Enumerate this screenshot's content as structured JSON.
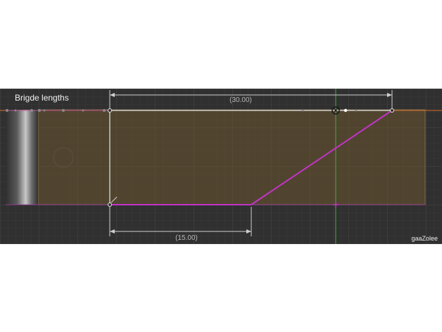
{
  "viewport": {
    "title": "Brigde lengths",
    "credit": "gaaZolee"
  },
  "dimensions": {
    "top_length": "(30.00)",
    "bottom_length": "(15.00)"
  },
  "colors": {
    "background": "#303030",
    "grid_minor": "#3a3a3a",
    "grid_major": "#444444",
    "face_fill": "#4a3d2a",
    "sketch_magenta": "#c234c7",
    "sketch_white": "#e6e6e6",
    "axis_green": "#3fae3f",
    "axis_orange": "#d9702a",
    "dimension_line": "#cfcfcf"
  }
}
